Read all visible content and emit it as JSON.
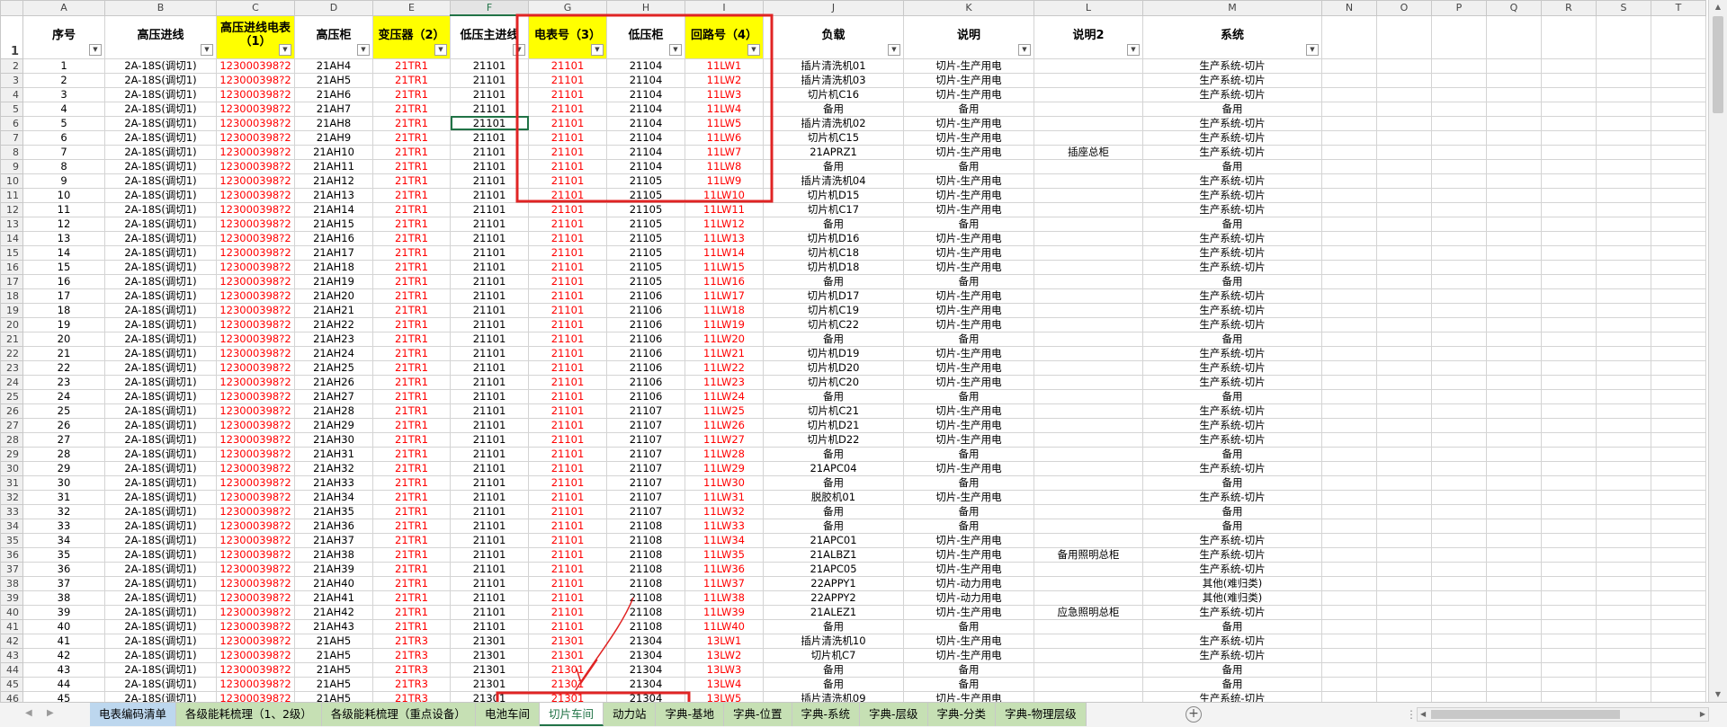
{
  "columns": [
    "A",
    "B",
    "C",
    "D",
    "E",
    "F",
    "G",
    "H",
    "I",
    "J",
    "K",
    "L",
    "M",
    "N",
    "O",
    "P",
    "Q",
    "R",
    "S",
    "T"
  ],
  "selected_column": "F",
  "header_row_num": "1",
  "headers": {
    "A": "序号",
    "B": "高压进线",
    "C": "高压进线电表（1）",
    "D": "高压柜",
    "E": "变压器（2）",
    "F": "低压主进线",
    "G": "电表号（3）",
    "H": "低压柜",
    "I": "回路号（4）",
    "J": "负载",
    "K": "说明",
    "L": "说明2",
    "M": "系统"
  },
  "rows": [
    {
      "n": "2",
      "a": "1",
      "b": "2A-18S(调切1)",
      "c": "123000398?2",
      "d": "21AH4",
      "e": "21TR1",
      "f": "21101",
      "g": "21101",
      "h": "21104",
      "i": "11LW1",
      "j": "插片清洗机01",
      "k": "切片-生产用电",
      "l": "",
      "m": "生产系统-切片"
    },
    {
      "n": "3",
      "a": "2",
      "b": "2A-18S(调切1)",
      "c": "123000398?2",
      "d": "21AH5",
      "e": "21TR1",
      "f": "21101",
      "g": "21101",
      "h": "21104",
      "i": "11LW2",
      "j": "插片清洗机03",
      "k": "切片-生产用电",
      "l": "",
      "m": "生产系统-切片"
    },
    {
      "n": "4",
      "a": "3",
      "b": "2A-18S(调切1)",
      "c": "123000398?2",
      "d": "21AH6",
      "e": "21TR1",
      "f": "21101",
      "g": "21101",
      "h": "21104",
      "i": "11LW3",
      "j": "切片机C16",
      "k": "切片-生产用电",
      "l": "",
      "m": "生产系统-切片"
    },
    {
      "n": "5",
      "a": "4",
      "b": "2A-18S(调切1)",
      "c": "123000398?2",
      "d": "21AH7",
      "e": "21TR1",
      "f": "21101",
      "g": "21101",
      "h": "21104",
      "i": "11LW4",
      "j": "备用",
      "k": "备用",
      "l": "",
      "m": "备用"
    },
    {
      "n": "6",
      "a": "5",
      "b": "2A-18S(调切1)",
      "c": "123000398?2",
      "d": "21AH8",
      "e": "21TR1",
      "f": "21101",
      "g": "21101",
      "h": "21104",
      "i": "11LW5",
      "j": "插片清洗机02",
      "k": "切片-生产用电",
      "l": "",
      "m": "生产系统-切片"
    },
    {
      "n": "7",
      "a": "6",
      "b": "2A-18S(调切1)",
      "c": "123000398?2",
      "d": "21AH9",
      "e": "21TR1",
      "f": "21101",
      "g": "21101",
      "h": "21104",
      "i": "11LW6",
      "j": "切片机C15",
      "k": "切片-生产用电",
      "l": "",
      "m": "生产系统-切片"
    },
    {
      "n": "8",
      "a": "7",
      "b": "2A-18S(调切1)",
      "c": "123000398?2",
      "d": "21AH10",
      "e": "21TR1",
      "f": "21101",
      "g": "21101",
      "h": "21104",
      "i": "11LW7",
      "j": "21APRZ1",
      "k": "切片-生产用电",
      "l": "插座总柜",
      "m": "生产系统-切片"
    },
    {
      "n": "9",
      "a": "8",
      "b": "2A-18S(调切1)",
      "c": "123000398?2",
      "d": "21AH11",
      "e": "21TR1",
      "f": "21101",
      "g": "21101",
      "h": "21104",
      "i": "11LW8",
      "j": "备用",
      "k": "备用",
      "l": "",
      "m": "备用"
    },
    {
      "n": "10",
      "a": "9",
      "b": "2A-18S(调切1)",
      "c": "123000398?2",
      "d": "21AH12",
      "e": "21TR1",
      "f": "21101",
      "g": "21101",
      "h": "21105",
      "i": "11LW9",
      "j": "插片清洗机04",
      "k": "切片-生产用电",
      "l": "",
      "m": "生产系统-切片"
    },
    {
      "n": "11",
      "a": "10",
      "b": "2A-18S(调切1)",
      "c": "123000398?2",
      "d": "21AH13",
      "e": "21TR1",
      "f": "21101",
      "g": "21101",
      "h": "21105",
      "i": "11LW10",
      "j": "切片机D15",
      "k": "切片-生产用电",
      "l": "",
      "m": "生产系统-切片"
    },
    {
      "n": "12",
      "a": "11",
      "b": "2A-18S(调切1)",
      "c": "123000398?2",
      "d": "21AH14",
      "e": "21TR1",
      "f": "21101",
      "g": "21101",
      "h": "21105",
      "i": "11LW11",
      "j": "切片机C17",
      "k": "切片-生产用电",
      "l": "",
      "m": "生产系统-切片"
    },
    {
      "n": "13",
      "a": "12",
      "b": "2A-18S(调切1)",
      "c": "123000398?2",
      "d": "21AH15",
      "e": "21TR1",
      "f": "21101",
      "g": "21101",
      "h": "21105",
      "i": "11LW12",
      "j": "备用",
      "k": "备用",
      "l": "",
      "m": "备用"
    },
    {
      "n": "14",
      "a": "13",
      "b": "2A-18S(调切1)",
      "c": "123000398?2",
      "d": "21AH16",
      "e": "21TR1",
      "f": "21101",
      "g": "21101",
      "h": "21105",
      "i": "11LW13",
      "j": "切片机D16",
      "k": "切片-生产用电",
      "l": "",
      "m": "生产系统-切片"
    },
    {
      "n": "15",
      "a": "14",
      "b": "2A-18S(调切1)",
      "c": "123000398?2",
      "d": "21AH17",
      "e": "21TR1",
      "f": "21101",
      "g": "21101",
      "h": "21105",
      "i": "11LW14",
      "j": "切片机C18",
      "k": "切片-生产用电",
      "l": "",
      "m": "生产系统-切片"
    },
    {
      "n": "16",
      "a": "15",
      "b": "2A-18S(调切1)",
      "c": "123000398?2",
      "d": "21AH18",
      "e": "21TR1",
      "f": "21101",
      "g": "21101",
      "h": "21105",
      "i": "11LW15",
      "j": "切片机D18",
      "k": "切片-生产用电",
      "l": "",
      "m": "生产系统-切片"
    },
    {
      "n": "17",
      "a": "16",
      "b": "2A-18S(调切1)",
      "c": "123000398?2",
      "d": "21AH19",
      "e": "21TR1",
      "f": "21101",
      "g": "21101",
      "h": "21105",
      "i": "11LW16",
      "j": "备用",
      "k": "备用",
      "l": "",
      "m": "备用"
    },
    {
      "n": "18",
      "a": "17",
      "b": "2A-18S(调切1)",
      "c": "123000398?2",
      "d": "21AH20",
      "e": "21TR1",
      "f": "21101",
      "g": "21101",
      "h": "21106",
      "i": "11LW17",
      "j": "切片机D17",
      "k": "切片-生产用电",
      "l": "",
      "m": "生产系统-切片"
    },
    {
      "n": "19",
      "a": "18",
      "b": "2A-18S(调切1)",
      "c": "123000398?2",
      "d": "21AH21",
      "e": "21TR1",
      "f": "21101",
      "g": "21101",
      "h": "21106",
      "i": "11LW18",
      "j": "切片机C19",
      "k": "切片-生产用电",
      "l": "",
      "m": "生产系统-切片"
    },
    {
      "n": "20",
      "a": "19",
      "b": "2A-18S(调切1)",
      "c": "123000398?2",
      "d": "21AH22",
      "e": "21TR1",
      "f": "21101",
      "g": "21101",
      "h": "21106",
      "i": "11LW19",
      "j": "切片机C22",
      "k": "切片-生产用电",
      "l": "",
      "m": "生产系统-切片"
    },
    {
      "n": "21",
      "a": "20",
      "b": "2A-18S(调切1)",
      "c": "123000398?2",
      "d": "21AH23",
      "e": "21TR1",
      "f": "21101",
      "g": "21101",
      "h": "21106",
      "i": "11LW20",
      "j": "备用",
      "k": "备用",
      "l": "",
      "m": "备用"
    },
    {
      "n": "22",
      "a": "21",
      "b": "2A-18S(调切1)",
      "c": "123000398?2",
      "d": "21AH24",
      "e": "21TR1",
      "f": "21101",
      "g": "21101",
      "h": "21106",
      "i": "11LW21",
      "j": "切片机D19",
      "k": "切片-生产用电",
      "l": "",
      "m": "生产系统-切片"
    },
    {
      "n": "23",
      "a": "22",
      "b": "2A-18S(调切1)",
      "c": "123000398?2",
      "d": "21AH25",
      "e": "21TR1",
      "f": "21101",
      "g": "21101",
      "h": "21106",
      "i": "11LW22",
      "j": "切片机D20",
      "k": "切片-生产用电",
      "l": "",
      "m": "生产系统-切片"
    },
    {
      "n": "24",
      "a": "23",
      "b": "2A-18S(调切1)",
      "c": "123000398?2",
      "d": "21AH26",
      "e": "21TR1",
      "f": "21101",
      "g": "21101",
      "h": "21106",
      "i": "11LW23",
      "j": "切片机C20",
      "k": "切片-生产用电",
      "l": "",
      "m": "生产系统-切片"
    },
    {
      "n": "25",
      "a": "24",
      "b": "2A-18S(调切1)",
      "c": "123000398?2",
      "d": "21AH27",
      "e": "21TR1",
      "f": "21101",
      "g": "21101",
      "h": "21106",
      "i": "11LW24",
      "j": "备用",
      "k": "备用",
      "l": "",
      "m": "备用"
    },
    {
      "n": "26",
      "a": "25",
      "b": "2A-18S(调切1)",
      "c": "123000398?2",
      "d": "21AH28",
      "e": "21TR1",
      "f": "21101",
      "g": "21101",
      "h": "21107",
      "i": "11LW25",
      "j": "切片机C21",
      "k": "切片-生产用电",
      "l": "",
      "m": "生产系统-切片"
    },
    {
      "n": "27",
      "a": "26",
      "b": "2A-18S(调切1)",
      "c": "123000398?2",
      "d": "21AH29",
      "e": "21TR1",
      "f": "21101",
      "g": "21101",
      "h": "21107",
      "i": "11LW26",
      "j": "切片机D21",
      "k": "切片-生产用电",
      "l": "",
      "m": "生产系统-切片"
    },
    {
      "n": "28",
      "a": "27",
      "b": "2A-18S(调切1)",
      "c": "123000398?2",
      "d": "21AH30",
      "e": "21TR1",
      "f": "21101",
      "g": "21101",
      "h": "21107",
      "i": "11LW27",
      "j": "切片机D22",
      "k": "切片-生产用电",
      "l": "",
      "m": "生产系统-切片"
    },
    {
      "n": "29",
      "a": "28",
      "b": "2A-18S(调切1)",
      "c": "123000398?2",
      "d": "21AH31",
      "e": "21TR1",
      "f": "21101",
      "g": "21101",
      "h": "21107",
      "i": "11LW28",
      "j": "备用",
      "k": "备用",
      "l": "",
      "m": "备用"
    },
    {
      "n": "30",
      "a": "29",
      "b": "2A-18S(调切1)",
      "c": "123000398?2",
      "d": "21AH32",
      "e": "21TR1",
      "f": "21101",
      "g": "21101",
      "h": "21107",
      "i": "11LW29",
      "j": "21APC04",
      "k": "切片-生产用电",
      "l": "",
      "m": "生产系统-切片"
    },
    {
      "n": "31",
      "a": "30",
      "b": "2A-18S(调切1)",
      "c": "123000398?2",
      "d": "21AH33",
      "e": "21TR1",
      "f": "21101",
      "g": "21101",
      "h": "21107",
      "i": "11LW30",
      "j": "备用",
      "k": "备用",
      "l": "",
      "m": "备用"
    },
    {
      "n": "32",
      "a": "31",
      "b": "2A-18S(调切1)",
      "c": "123000398?2",
      "d": "21AH34",
      "e": "21TR1",
      "f": "21101",
      "g": "21101",
      "h": "21107",
      "i": "11LW31",
      "j": "脱胶机01",
      "k": "切片-生产用电",
      "l": "",
      "m": "生产系统-切片"
    },
    {
      "n": "33",
      "a": "32",
      "b": "2A-18S(调切1)",
      "c": "123000398?2",
      "d": "21AH35",
      "e": "21TR1",
      "f": "21101",
      "g": "21101",
      "h": "21107",
      "i": "11LW32",
      "j": "备用",
      "k": "备用",
      "l": "",
      "m": "备用"
    },
    {
      "n": "34",
      "a": "33",
      "b": "2A-18S(调切1)",
      "c": "123000398?2",
      "d": "21AH36",
      "e": "21TR1",
      "f": "21101",
      "g": "21101",
      "h": "21108",
      "i": "11LW33",
      "j": "备用",
      "k": "备用",
      "l": "",
      "m": "备用"
    },
    {
      "n": "35",
      "a": "34",
      "b": "2A-18S(调切1)",
      "c": "123000398?2",
      "d": "21AH37",
      "e": "21TR1",
      "f": "21101",
      "g": "21101",
      "h": "21108",
      "i": "11LW34",
      "j": "21APC01",
      "k": "切片-生产用电",
      "l": "",
      "m": "生产系统-切片"
    },
    {
      "n": "36",
      "a": "35",
      "b": "2A-18S(调切1)",
      "c": "123000398?2",
      "d": "21AH38",
      "e": "21TR1",
      "f": "21101",
      "g": "21101",
      "h": "21108",
      "i": "11LW35",
      "j": "21ALBZ1",
      "k": "切片-生产用电",
      "l": "备用照明总柜",
      "m": "生产系统-切片"
    },
    {
      "n": "37",
      "a": "36",
      "b": "2A-18S(调切1)",
      "c": "123000398?2",
      "d": "21AH39",
      "e": "21TR1",
      "f": "21101",
      "g": "21101",
      "h": "21108",
      "i": "11LW36",
      "j": "21APC05",
      "k": "切片-生产用电",
      "l": "",
      "m": "生产系统-切片"
    },
    {
      "n": "38",
      "a": "37",
      "b": "2A-18S(调切1)",
      "c": "123000398?2",
      "d": "21AH40",
      "e": "21TR1",
      "f": "21101",
      "g": "21101",
      "h": "21108",
      "i": "11LW37",
      "j": "22APPY1",
      "k": "切片-动力用电",
      "l": "",
      "m": "其他(难归类)"
    },
    {
      "n": "39",
      "a": "38",
      "b": "2A-18S(调切1)",
      "c": "123000398?2",
      "d": "21AH41",
      "e": "21TR1",
      "f": "21101",
      "g": "21101",
      "h": "21108",
      "i": "11LW38",
      "j": "22APPY2",
      "k": "切片-动力用电",
      "l": "",
      "m": "其他(难归类)"
    },
    {
      "n": "40",
      "a": "39",
      "b": "2A-18S(调切1)",
      "c": "123000398?2",
      "d": "21AH42",
      "e": "21TR1",
      "f": "21101",
      "g": "21101",
      "h": "21108",
      "i": "11LW39",
      "j": "21ALEZ1",
      "k": "切片-生产用电",
      "l": "应急照明总柜",
      "m": "生产系统-切片"
    },
    {
      "n": "41",
      "a": "40",
      "b": "2A-18S(调切1)",
      "c": "123000398?2",
      "d": "21AH43",
      "e": "21TR1",
      "f": "21101",
      "g": "21101",
      "h": "21108",
      "i": "11LW40",
      "j": "备用",
      "k": "备用",
      "l": "",
      "m": "备用"
    },
    {
      "n": "42",
      "a": "41",
      "b": "2A-18S(调切1)",
      "c": "123000398?2",
      "d": "21AH5",
      "e": "21TR3",
      "f": "21301",
      "g": "21301",
      "h": "21304",
      "i": "13LW1",
      "j": "插片清洗机10",
      "k": "切片-生产用电",
      "l": "",
      "m": "生产系统-切片"
    },
    {
      "n": "43",
      "a": "42",
      "b": "2A-18S(调切1)",
      "c": "123000398?2",
      "d": "21AH5",
      "e": "21TR3",
      "f": "21301",
      "g": "21301",
      "h": "21304",
      "i": "13LW2",
      "j": "切片机C7",
      "k": "切片-生产用电",
      "l": "",
      "m": "生产系统-切片"
    },
    {
      "n": "44",
      "a": "43",
      "b": "2A-18S(调切1)",
      "c": "123000398?2",
      "d": "21AH5",
      "e": "21TR3",
      "f": "21301",
      "g": "21301",
      "h": "21304",
      "i": "13LW3",
      "j": "备用",
      "k": "备用",
      "l": "",
      "m": "备用"
    },
    {
      "n": "45",
      "a": "44",
      "b": "2A-18S(调切1)",
      "c": "123000398?2",
      "d": "21AH5",
      "e": "21TR3",
      "f": "21301",
      "g": "21301",
      "h": "21304",
      "i": "13LW4",
      "j": "备用",
      "k": "备用",
      "l": "",
      "m": "备用"
    },
    {
      "n": "46",
      "a": "45",
      "b": "2A-18S(调切1)",
      "c": "123000398?2",
      "d": "21AH5",
      "e": "21TR3",
      "f": "21301",
      "g": "21301",
      "h": "21304",
      "i": "13LW5",
      "j": "插片清洗机09",
      "k": "切片-生产用电",
      "l": "",
      "m": "生产系统-切片"
    }
  ],
  "sheet_tabs": [
    {
      "label": "电表编码清单",
      "color": "#bdd7ee",
      "active": false
    },
    {
      "label": "各级能耗梳理（1、2级）",
      "color": "#c6e0b4",
      "active": false
    },
    {
      "label": "各级能耗梳理（重点设备）",
      "color": "#c6e0b4",
      "active": false
    },
    {
      "label": "电池车间",
      "color": "#c6e0b4",
      "active": false
    },
    {
      "label": "切片车间",
      "color": "#ffffff",
      "active": true
    },
    {
      "label": "动力站",
      "color": "#c6e0b4",
      "active": false
    },
    {
      "label": "字典-基地",
      "color": "#c6e0b4",
      "active": false
    },
    {
      "label": "字典-位置",
      "color": "#c6e0b4",
      "active": false
    },
    {
      "label": "字典-系统",
      "color": "#c6e0b4",
      "active": false
    },
    {
      "label": "字典-层级",
      "color": "#c6e0b4",
      "active": false
    },
    {
      "label": "字典-分类",
      "color": "#c6e0b4",
      "active": false
    },
    {
      "label": "字典-物理层级",
      "color": "#c6e0b4",
      "active": false
    }
  ],
  "colors": {
    "header_yellow": "#ffff00",
    "red_text": "#ff0000",
    "annotation_red": "#e02424",
    "excel_green": "#217346"
  },
  "icons": {
    "filter": "filter-dropdown-icon",
    "add_sheet": "add-sheet-icon",
    "nav_left": "tab-nav-left-icon",
    "nav_right": "tab-nav-right-icon"
  },
  "glyphs": {
    "add": "+",
    "prev": "◀",
    "next": "▶",
    "up": "▲",
    "down": "▼",
    "sep": "⋮",
    "filter": "▼"
  }
}
